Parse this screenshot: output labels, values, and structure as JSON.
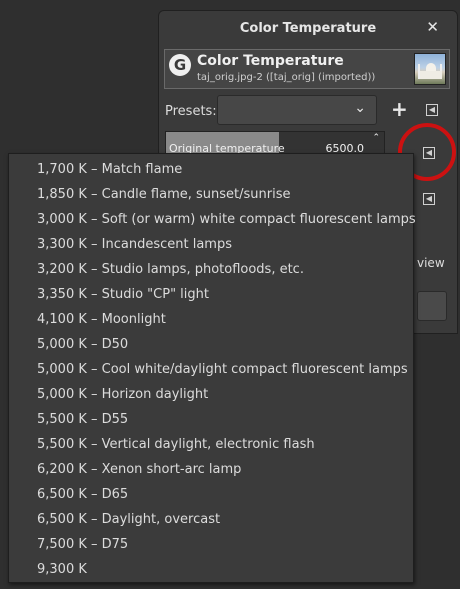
{
  "dialog": {
    "title": "Color Temperature",
    "close_glyph": "✕",
    "header_title": "Color Temperature",
    "header_subtitle": "taj_orig.jpg-2 ([taj_orig] (imported))",
    "logo_letter": "G",
    "presets_label": "Presets:",
    "presets_value": "",
    "add_glyph": "+",
    "reset_glyph": "◀",
    "original_temperature_label": "Original temperature",
    "original_temperature_value": "6500.0",
    "original_temperature_fraction": 0.52,
    "preview_label": "view"
  },
  "menu": {
    "items": [
      "1,700 K – Match flame",
      "1,850 K – Candle flame, sunset/sunrise",
      "3,000 K – Soft (or warm) white compact fluorescent lamps",
      "3,300 K – Incandescent lamps",
      "3,200 K – Studio lamps, photofloods, etc.",
      "3,350 K – Studio \"CP\" light",
      "4,100 K – Moonlight",
      "5,000 K – D50",
      "5,000 K – Cool white/daylight compact fluorescent lamps",
      "5,000 K – Horizon daylight",
      "5,500 K – D55",
      "5,500 K – Vertical daylight, electronic flash",
      "6,200 K – Xenon short-arc lamp",
      "6,500 K – D65",
      "6,500 K – Daylight, overcast",
      "7,500 K – D75",
      "9,300 K"
    ]
  },
  "colors": {
    "highlight": "#cc1111",
    "background": "#2f2f2f"
  }
}
